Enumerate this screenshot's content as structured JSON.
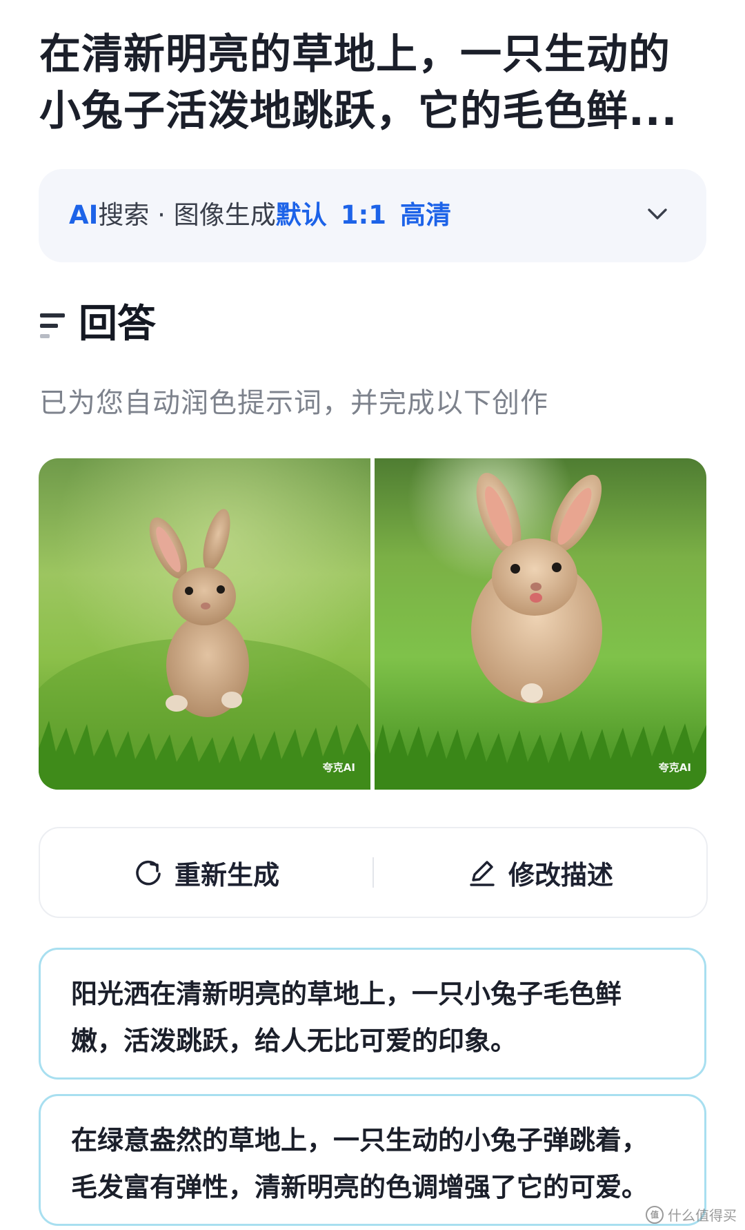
{
  "title": {
    "line1": "在清新明亮的草地上，一只生动的",
    "line2": "小兔子活泼地跳跃，它的毛色鲜..."
  },
  "mode_bar": {
    "ai": "AI",
    "search": "搜索",
    "separator": " · ",
    "mode": "图像生成",
    "style": "默认",
    "ratio": "1:1",
    "quality": "高清",
    "expand_icon": "chevron-down-icon"
  },
  "answer": {
    "icon": "list-icon",
    "heading": "回答",
    "subtitle": "已为您自动润色提示词，并完成以下创作"
  },
  "images": [
    {
      "watermark": "夸克AI"
    },
    {
      "watermark": "夸克AI"
    }
  ],
  "actions": {
    "regenerate": {
      "label": "重新生成",
      "icon": "refresh-icon"
    },
    "edit": {
      "label": "修改描述",
      "icon": "pencil-icon"
    }
  },
  "prompts": [
    {
      "line1": "阳光洒在清新明亮的草地上，一只小兔子毛色鲜",
      "line2": "嫩，活泼跳跃，给人无比可爱的印象。"
    },
    {
      "line1": "在绿意盎然的草地上，一只生动的小兔子弹跳着，",
      "line2": "毛发富有弹性，清新明亮的色调增强了它的可爱。"
    }
  ],
  "site_watermark": {
    "logo": "值",
    "text": "什么值得买"
  },
  "colors": {
    "accent_blue": "#1d63e8",
    "card_border": "#a8dff0",
    "mode_bg": "#f4f6fb",
    "subtitle_gray": "#7d828c"
  }
}
